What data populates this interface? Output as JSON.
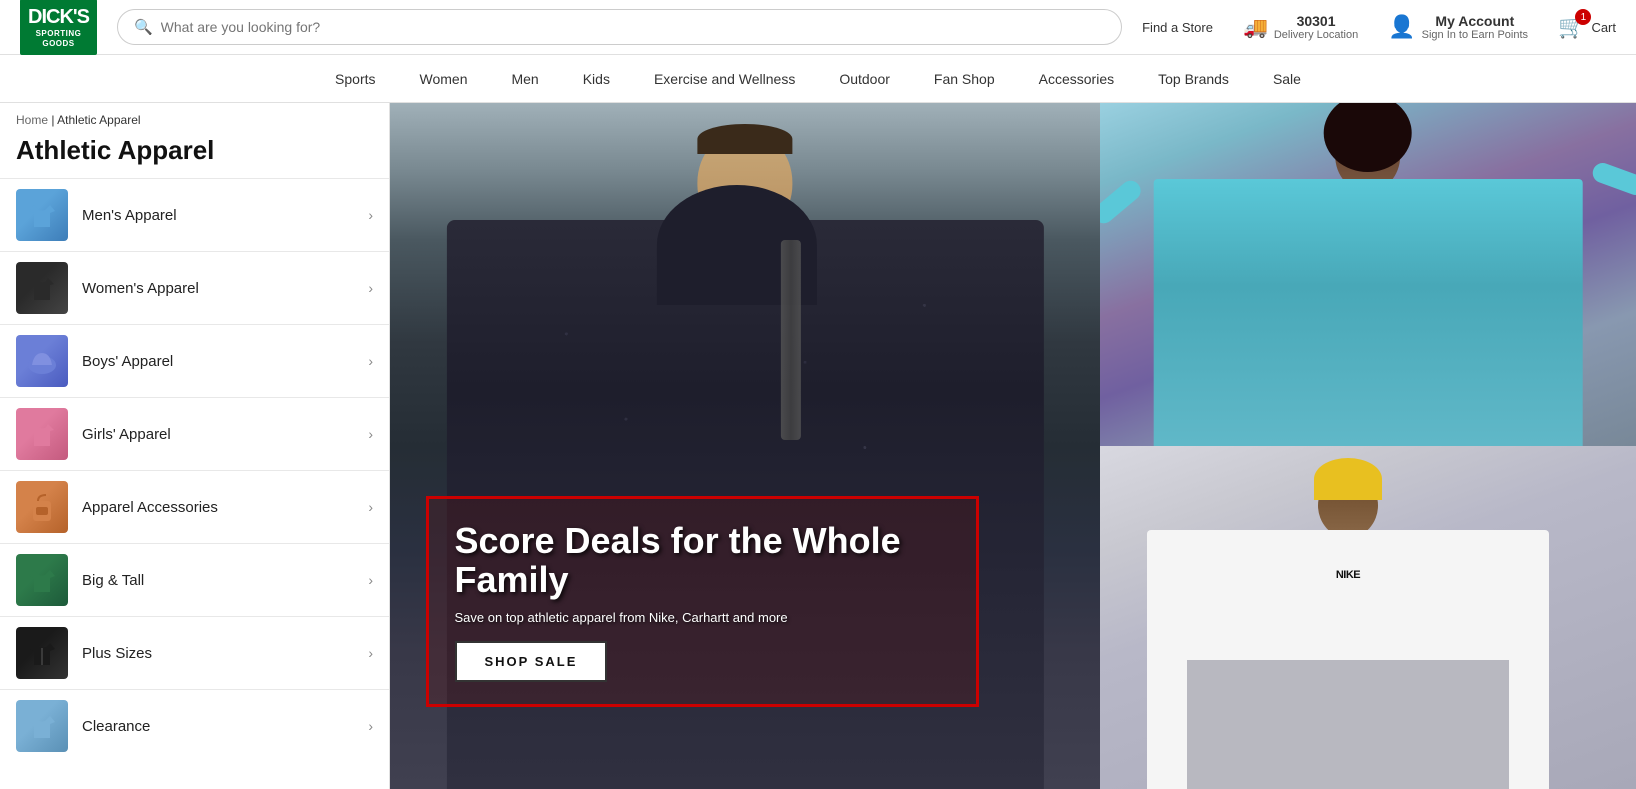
{
  "header": {
    "logo_line1": "DICK'S",
    "logo_line2": "SPORTING",
    "logo_line3": "GOODS",
    "search_placeholder": "What are you looking for?",
    "find_store_label": "Find a Store",
    "delivery_zip": "30301",
    "delivery_label": "Delivery Location",
    "account_label": "My Account",
    "account_sub": "Sign In to Earn Points",
    "cart_label": "Cart",
    "cart_count": "1"
  },
  "nav": {
    "items": [
      {
        "label": "Sports"
      },
      {
        "label": "Women"
      },
      {
        "label": "Men"
      },
      {
        "label": "Kids"
      },
      {
        "label": "Exercise and Wellness"
      },
      {
        "label": "Outdoor"
      },
      {
        "label": "Fan Shop"
      },
      {
        "label": "Accessories"
      },
      {
        "label": "Top Brands"
      },
      {
        "label": "Sale"
      }
    ]
  },
  "breadcrumb": {
    "home": "Home",
    "separator": "|",
    "current": "Athletic Apparel"
  },
  "page_title": "Athletic Apparel",
  "sidebar": {
    "items": [
      {
        "label": "Men's Apparel",
        "thumb_class": "thumb-mens"
      },
      {
        "label": "Women's Apparel",
        "thumb_class": "thumb-womens"
      },
      {
        "label": "Boys' Apparel",
        "thumb_class": "thumb-boys"
      },
      {
        "label": "Girls' Apparel",
        "thumb_class": "thumb-girls"
      },
      {
        "label": "Apparel Accessories",
        "thumb_class": "thumb-accessories"
      },
      {
        "label": "Big & Tall",
        "thumb_class": "thumb-bigtall"
      },
      {
        "label": "Plus Sizes",
        "thumb_class": "thumb-plus"
      },
      {
        "label": "Clearance",
        "thumb_class": "thumb-clearance"
      }
    ]
  },
  "promo": {
    "headline": "Score Deals for the Whole Family",
    "subtext": "Save on top athletic apparel from Nike, Carhartt and more",
    "cta_label": "SHOP SALE"
  }
}
